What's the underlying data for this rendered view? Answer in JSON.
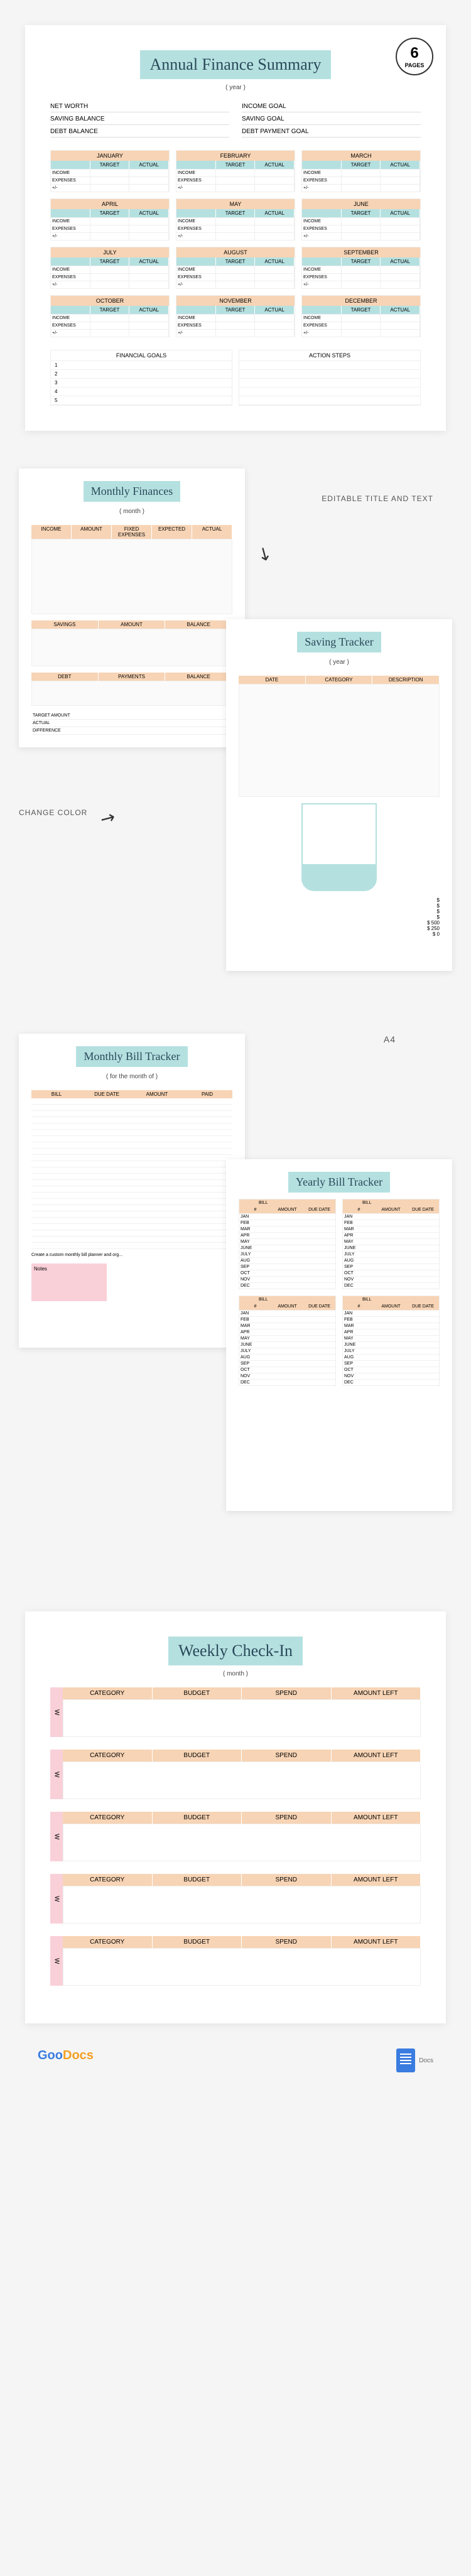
{
  "badge": {
    "number": "6",
    "label": "PAGES"
  },
  "page1": {
    "title": "Annual Finance Summary",
    "subtitle": "( year )",
    "left_keys": [
      "NET WORTH",
      "SAVING BALANCE",
      "DEBT BALANCE"
    ],
    "right_keys": [
      "INCOME GOAL",
      "SAVING GOAL",
      "DEBT PAYMENT GOAL"
    ],
    "months": [
      "JANUARY",
      "FEBRUARY",
      "MARCH",
      "APRIL",
      "MAY",
      "JUNE",
      "JULY",
      "AUGUST",
      "SEPTEMBER",
      "OCTOBER",
      "NOVEMBER",
      "DECEMBER"
    ],
    "month_cols": [
      "",
      "TARGET",
      "ACTUAL"
    ],
    "month_rows": [
      "INCOME",
      "EXPENSES",
      "+/-"
    ],
    "goals": {
      "left": "FINANCIAL GOALS",
      "right": "ACTION STEPS",
      "rows": [
        "1",
        "2",
        "3",
        "4",
        "5"
      ]
    }
  },
  "section2": {
    "monthly": {
      "title": "Monthly Finances",
      "subtitle": "( month )",
      "cols1": [
        "INCOME",
        "AMOUNT",
        "FIXED EXPENSES",
        "EXPECTED",
        "ACTUAL"
      ],
      "cols2": [
        "SAVINGS",
        "AMOUNT",
        "BALANCE"
      ],
      "cols3": [
        "DEBT",
        "PAYMENTS",
        "BALANCE"
      ],
      "summary": [
        "TARGET AMOUNT",
        "ACTUAL",
        "DIFFERENCE"
      ]
    },
    "saving": {
      "title": "Saving Tracker",
      "subtitle": "( year )",
      "cols": [
        "DATE",
        "CATEGORY",
        "DESCRIPTION"
      ],
      "scale": [
        "$",
        "$",
        "$",
        "$",
        "$ 500",
        "$ 250",
        "$ 0"
      ]
    },
    "feature_title": "EDITABLE TITLE AND TEXT",
    "feature_color": "CHANGE COLOR"
  },
  "section3": {
    "a4_label": "A4",
    "monthly_bill": {
      "title": "Monthly Bill Tracker",
      "subtitle": "( for the month of )",
      "cols": [
        "BILL",
        "DUE DATE",
        "AMOUNT",
        "PAID"
      ],
      "note": "Create a custom monthly bill planner and org...",
      "notes_label": "Notes"
    },
    "yearly_bill": {
      "title": "Yearly Bill Tracker",
      "cell_head1": [
        "BILL",
        ""
      ],
      "sub_head": [
        "#",
        "AMOUNT",
        "DUE DATE"
      ],
      "months": [
        "JAN",
        "FEB",
        "MAR",
        "APR",
        "MAY",
        "JUNE",
        "JULY",
        "AUG",
        "SEP",
        "OCT",
        "NOV",
        "DEC"
      ]
    }
  },
  "page5": {
    "title": "Weekly Check-In",
    "subtitle": "( month )",
    "week_label": "W",
    "cols": [
      "CATEGORY",
      "BUDGET",
      "SPEND",
      "AMOUNT LEFT"
    ]
  },
  "footer": {
    "brand1": "Goo",
    "brand2": "Docs",
    "docs": "Docs"
  }
}
